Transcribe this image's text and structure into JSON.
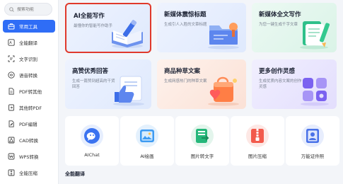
{
  "sidebar": {
    "search_placeholder": "搜索功能",
    "items": [
      {
        "label": "常用工具",
        "icon": "toolbox-icon"
      },
      {
        "label": "全能翻译",
        "icon": "translate-icon"
      },
      {
        "label": "文字识别",
        "icon": "text-recognition-icon"
      },
      {
        "label": "语音转换",
        "icon": "voice-convert-icon"
      },
      {
        "label": "PDF转其他",
        "icon": "pdf-icon"
      },
      {
        "label": "其他转PDF",
        "icon": "pdf-convert-icon"
      },
      {
        "label": "PDF编辑",
        "icon": "pdf-edit-icon"
      },
      {
        "label": "CAD转换",
        "icon": "cad-icon"
      },
      {
        "label": "WPS转换",
        "icon": "wps-icon"
      },
      {
        "label": "全能压缩",
        "icon": "compress-icon"
      }
    ]
  },
  "cards": [
    {
      "title": "AI全能写作",
      "desc": "最懂你的智能写作助手"
    },
    {
      "title": "新媒体震惊标题",
      "desc": "生成引人入胜的文章标题"
    },
    {
      "title": "新媒体全文写作",
      "desc": "为您一键生成千字文章"
    },
    {
      "title": "高赞优秀回答",
      "desc": "生成一篇赞到超高的干货回答"
    },
    {
      "title": "商品种草文案",
      "desc": "生成网感热门的种草文案"
    },
    {
      "title": "更多创作灵感",
      "desc": "生成优质内容文案的创作灵感"
    }
  ],
  "tools": [
    {
      "label": "AIChat",
      "icon": "ai-chat-icon"
    },
    {
      "label": "AI绘画",
      "icon": "ai-painting-icon"
    },
    {
      "label": "图片转文字",
      "icon": "image-to-text-icon"
    },
    {
      "label": "图片压缩",
      "icon": "image-compress-icon"
    },
    {
      "label": "万能证件照",
      "icon": "id-photo-icon"
    }
  ],
  "section": {
    "title": "全能翻译"
  },
  "colors": {
    "accent": "#2f6df6",
    "selected_border": "#e0392b",
    "card_blue": "#e6effe",
    "card_green": "#e3f6ee",
    "card_orange": "#fdece4",
    "card_purple": "#eceafd"
  }
}
